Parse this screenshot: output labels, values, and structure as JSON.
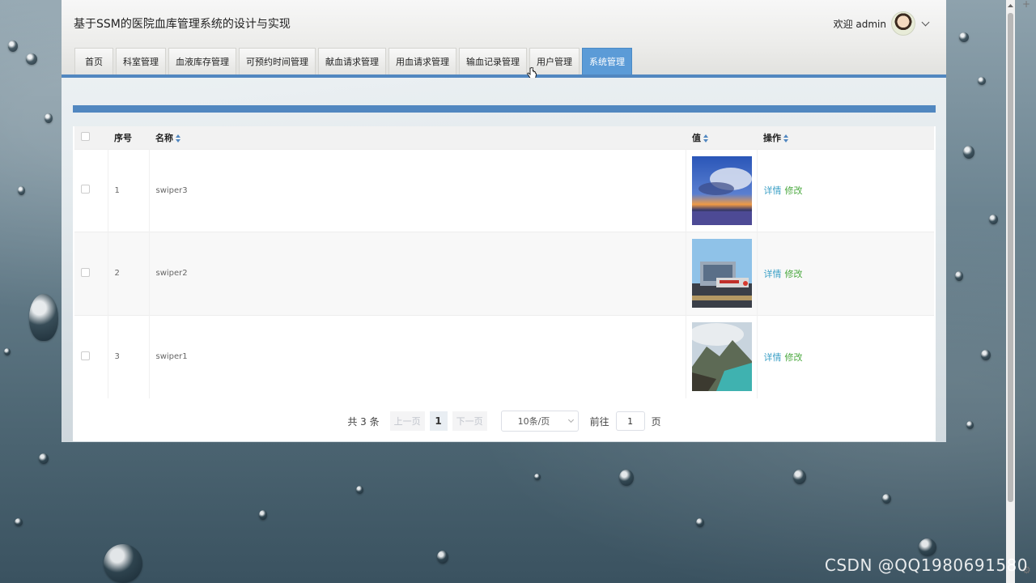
{
  "app": {
    "title": "基于SSM的医院血库管理系统的设计与实现"
  },
  "user": {
    "welcome": "欢迎 admin"
  },
  "nav": {
    "items": [
      {
        "label": "首页"
      },
      {
        "label": "科室管理"
      },
      {
        "label": "血液库存管理"
      },
      {
        "label": "可预约时间管理"
      },
      {
        "label": "献血请求管理"
      },
      {
        "label": "用血请求管理"
      },
      {
        "label": "输血记录管理"
      },
      {
        "label": "用户管理"
      },
      {
        "label": "系统管理"
      }
    ],
    "active": "系统管理"
  },
  "table": {
    "headers": {
      "index": "序号",
      "name": "名称",
      "value": "值",
      "action": "操作"
    },
    "rows": [
      {
        "index": "1",
        "name": "swiper3",
        "image": "sunset-lake-image",
        "detail": "详情",
        "edit": "修改"
      },
      {
        "index": "2",
        "name": "swiper2",
        "image": "hospital-building-image",
        "detail": "详情",
        "edit": "修改"
      },
      {
        "index": "3",
        "name": "swiper1",
        "image": "mountain-lake-image",
        "detail": "详情",
        "edit": "修改"
      }
    ]
  },
  "pager": {
    "total": "共 3 条",
    "prev": "上一页",
    "current": "1",
    "next": "下一页",
    "page_size": "10条/页",
    "goto": "前往",
    "goto_value": "1",
    "page_unit": "页"
  },
  "watermark": "CSDN @QQ1980691580",
  "colors": {
    "accent": "#5187c0",
    "active_tab": "#5b9bd7",
    "detail_link": "#3ca0c6",
    "edit_link": "#4aa83e"
  }
}
